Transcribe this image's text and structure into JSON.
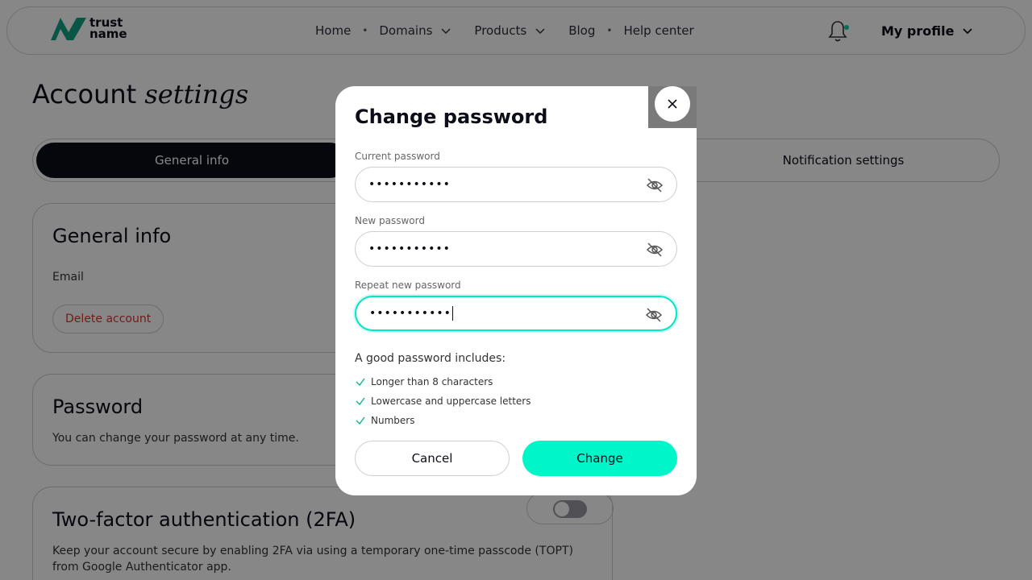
{
  "header": {
    "logo_line1": "trust",
    "logo_line2": "name",
    "nav": [
      "Home",
      "Domains",
      "Products",
      "Blog",
      "Help center"
    ],
    "profile_label": "My profile"
  },
  "page": {
    "title_plain": "Account",
    "title_italic": "settings"
  },
  "tabs": {
    "active": "General info",
    "notifications": "Notification settings"
  },
  "general_card": {
    "title": "General info",
    "email_label": "Email",
    "delete_label": "Delete account"
  },
  "password_card": {
    "title": "Password",
    "text": "You can change your password at any time."
  },
  "twofa_card": {
    "title": "Two-factor authentication (2FA)",
    "text": "Keep your account secure by enabling 2FA via using a temporary one-time passcode (TOPT) from Google Authenticator app."
  },
  "modal": {
    "title": "Change password",
    "current_label": "Current password",
    "current_value": "•••••••••••",
    "new_label": "New password",
    "new_value": "•••••••••••",
    "repeat_label": "Repeat new password",
    "repeat_value": "•••••••••••",
    "hint_title": "A good password includes:",
    "hints": [
      "Longer than 8 characters",
      "Lowercase and uppercase letters",
      "Numbers"
    ],
    "cancel_label": "Cancel",
    "change_label": "Change"
  },
  "colors": {
    "accent": "#00f5c8",
    "dark": "#0d0d1a",
    "danger": "#e0322a",
    "notification_dot": "#00d9a0"
  }
}
